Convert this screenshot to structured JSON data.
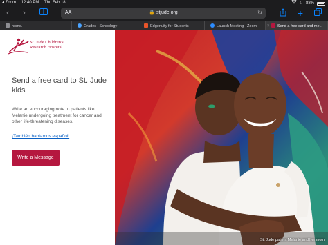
{
  "status_bar": {
    "carrier": "◂ Zoom",
    "time": "12:40 PM",
    "date": "Thu Feb 18",
    "battery": "88%"
  },
  "toolbar": {
    "aa_label": "AA",
    "url": "🔒 stjude.org"
  },
  "tabs": [
    {
      "label": "home.",
      "icon_color": "#8e8e93"
    },
    {
      "label": "Grades | Schoology",
      "icon_color": "#4aa3ff"
    },
    {
      "label": "Edgenuity for Students",
      "icon_color": "#e8552a"
    },
    {
      "label": "Launch Meeting - Zoom",
      "icon_color": "#2d8cff"
    },
    {
      "label": "Send a free card and me...",
      "icon_color": "#b5173f"
    }
  ],
  "page": {
    "logo_line1": "St. Jude Children's",
    "logo_line2": "Research Hospital",
    "headline": "Send a free card to St. Jude kids",
    "body": "Write an encouraging note to patients like Melanie undergoing treatment for cancer and other life-threatening diseases.",
    "spanish_link": "¡También hablamos español!",
    "cta_label": "Write a Message",
    "photo_caption": "St. Jude patient Melanie and her mom"
  },
  "colors": {
    "brand": "#b5173f",
    "link": "#0b61c4"
  }
}
